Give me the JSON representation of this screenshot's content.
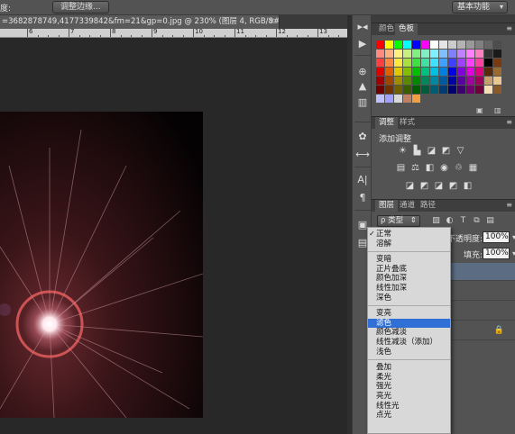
{
  "options_bar": {
    "left_label": "度:",
    "button_label": "调整边缘...",
    "workspace": "基本功能",
    "workspace_arrow": "▾"
  },
  "document_tab": {
    "title": "=3682878749,4177339842&fm=21&gp=0.jpg @ 230% (图层 4, RGB/8#) *",
    "close": "×"
  },
  "ruler": {
    "labels": [
      "6",
      "7",
      "8",
      "9",
      "10",
      "11",
      "12",
      "13"
    ]
  },
  "panels": {
    "color": {
      "tabs": [
        "颜色",
        "色板"
      ],
      "swatch_colors": [
        "#ff0000",
        "#ffff00",
        "#00ff00",
        "#00ffff",
        "#0000ff",
        "#ff00ff",
        "#ffffff",
        "#e6e6e6",
        "#cccccc",
        "#b3b3b3",
        "#999999",
        "#808080",
        "#666666",
        "#4d4d4d",
        "#ff8a80",
        "#ffb080",
        "#fff080",
        "#c8f080",
        "#80f080",
        "#80f0c0",
        "#80f0ff",
        "#80c0ff",
        "#8080ff",
        "#c080ff",
        "#ff80ff",
        "#ff80c0",
        "#333333",
        "#1a1a1a",
        "#ff4040",
        "#ff8840",
        "#ffe840",
        "#a8e040",
        "#40e040",
        "#40e0a0",
        "#40e0ff",
        "#40a0ff",
        "#4040ff",
        "#a040ff",
        "#ff40ff",
        "#ff40a0",
        "#000000",
        "#7a3a10",
        "#e00000",
        "#e06000",
        "#e0c800",
        "#80c000",
        "#00c000",
        "#00c080",
        "#00c0e0",
        "#0080e0",
        "#0000e0",
        "#8000e0",
        "#e000e0",
        "#e00080",
        "#5a2a08",
        "#9a6a30",
        "#a00000",
        "#a04400",
        "#a08c00",
        "#5a8800",
        "#008800",
        "#00885a",
        "#0088a0",
        "#005aa0",
        "#0000a0",
        "#5a00a0",
        "#a000a0",
        "#a0005a",
        "#c8a070",
        "#e8c890",
        "#700000",
        "#703000",
        "#706000",
        "#3c5c00",
        "#005c00",
        "#005c3c",
        "#005c70",
        "#003c70",
        "#000070",
        "#3c0070",
        "#700070",
        "#70003c",
        "#f5deb3",
        "#8b5a2b",
        "#c0c0ff",
        "#a0a0ff",
        "#d8d8d8",
        "#c08060",
        "#f0a040"
      ]
    },
    "adjustments": {
      "tabs": [
        "调整",
        "样式"
      ],
      "title": "添加调整",
      "row1": [
        "☀",
        "▙",
        "◪",
        "◩",
        "▽"
      ],
      "row2": [
        "▤",
        "⚖",
        "◧",
        "◉",
        "♲",
        "▦"
      ],
      "row3": [
        "◪",
        "◩",
        "◪",
        "◩",
        "◧"
      ]
    },
    "layers": {
      "tabs": [
        "图层",
        "通道",
        "路径"
      ],
      "kind_label": "ρ 类型",
      "tool_icons": [
        "▨",
        "◐",
        "T",
        "⧉",
        "▤"
      ],
      "opacity_label": "不透明度:",
      "opacity_value": "100%",
      "fill_label": "填充:",
      "fill_value": "100%",
      "lock_icon": "🔒"
    }
  },
  "dock_icons": [
    "▸◂",
    "▶",
    "⊕",
    "▲",
    "▥",
    "✿",
    "⟷",
    "A|",
    "¶",
    "▣",
    "▤"
  ],
  "blend_mode_menu": {
    "items": [
      {
        "label": "正常",
        "checked": true,
        "selected": false,
        "sep_after": false
      },
      {
        "label": "溶解",
        "checked": false,
        "selected": false,
        "sep_after": true
      },
      {
        "label": "变暗",
        "checked": false,
        "selected": false,
        "sep_after": false
      },
      {
        "label": "正片叠底",
        "checked": false,
        "selected": false,
        "sep_after": false
      },
      {
        "label": "颜色加深",
        "checked": false,
        "selected": false,
        "sep_after": false
      },
      {
        "label": "线性加深",
        "checked": false,
        "selected": false,
        "sep_after": false
      },
      {
        "label": "深色",
        "checked": false,
        "selected": false,
        "sep_after": true
      },
      {
        "label": "变亮",
        "checked": false,
        "selected": false,
        "sep_after": false
      },
      {
        "label": "滤色",
        "checked": false,
        "selected": true,
        "sep_after": false
      },
      {
        "label": "颜色减淡",
        "checked": false,
        "selected": false,
        "sep_after": false
      },
      {
        "label": "线性减淡（添加）",
        "checked": false,
        "selected": false,
        "sep_after": false
      },
      {
        "label": "浅色",
        "checked": false,
        "selected": false,
        "sep_after": true
      },
      {
        "label": "叠加",
        "checked": false,
        "selected": false,
        "sep_after": false
      },
      {
        "label": "柔光",
        "checked": false,
        "selected": false,
        "sep_after": false
      },
      {
        "label": "强光",
        "checked": false,
        "selected": false,
        "sep_after": false
      },
      {
        "label": "亮光",
        "checked": false,
        "selected": false,
        "sep_after": false
      },
      {
        "label": "线性光",
        "checked": false,
        "selected": false,
        "sep_after": false
      },
      {
        "label": "点光",
        "checked": false,
        "selected": false,
        "sep_after": false
      }
    ],
    "check_glyph": "✓"
  }
}
